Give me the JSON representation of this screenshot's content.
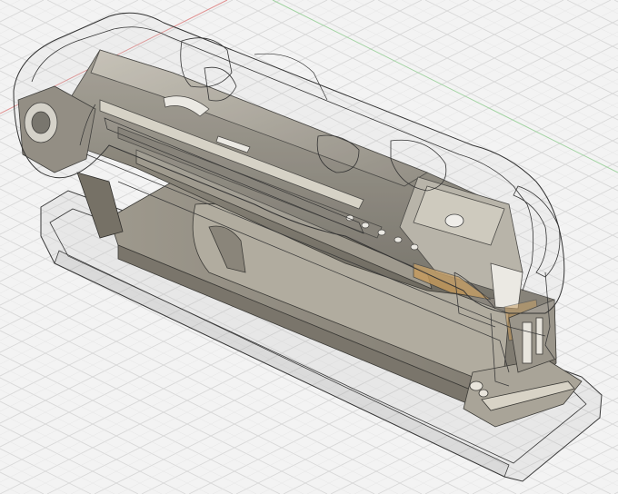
{
  "viewport": {
    "background": "#f3f3f3",
    "grid_color": "#d7d7d7",
    "grid_minor_color": "#e6e6e6",
    "axis_x_color": "#e08f8f",
    "axis_y_color": "#9fd29f",
    "view_mode": "isometric",
    "visual_style": "shaded with hidden edges"
  },
  "model": {
    "component": "stapler",
    "body_color": "#8f8a7f",
    "body_light_color": "#b5b0a4",
    "body_dark_color": "#6e6a61",
    "ghost_outline_color": "#3a3a3a",
    "highlight_color": "#c79b5b"
  }
}
